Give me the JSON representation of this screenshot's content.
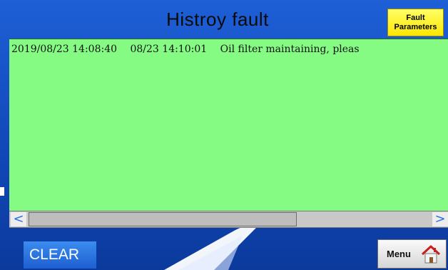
{
  "header": {
    "title": "Histroy fault",
    "fault_parameters_line1": "Fault",
    "fault_parameters_line2": "Parameters"
  },
  "fault_list": {
    "rows": [
      {
        "date_time": "2019/08/23 14:08:40",
        "clear_time": "08/23 14:10:01",
        "message": "Oil filter maintaining, pleas"
      }
    ],
    "background_color": "#86fb84"
  },
  "scrollbar": {
    "left_arrow": "<",
    "right_arrow": ">"
  },
  "footer": {
    "clear_label": "CLEAR",
    "menu_label": "Menu"
  },
  "icons": {
    "menu_icon": "house-icon"
  },
  "colors": {
    "background": "#1a55cc",
    "fault_button": "#ffee22",
    "clear_button": "#2a72e4"
  }
}
